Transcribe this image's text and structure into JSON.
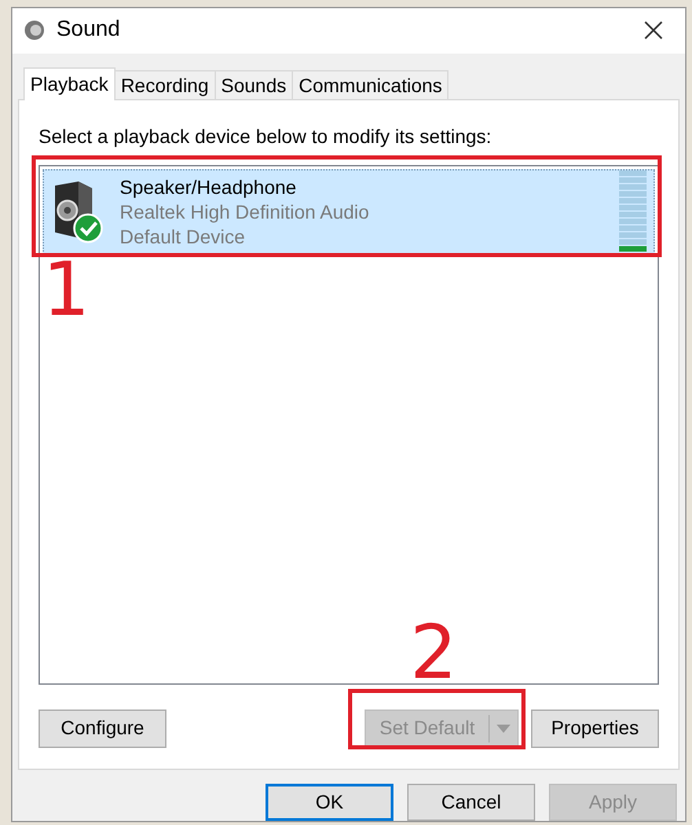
{
  "window": {
    "title": "Sound"
  },
  "tabs": [
    {
      "label": "Playback",
      "selected": true
    },
    {
      "label": "Recording",
      "selected": false
    },
    {
      "label": "Sounds",
      "selected": false
    },
    {
      "label": "Communications",
      "selected": false
    }
  ],
  "instruction": "Select a playback device below to modify its settings:",
  "devices": [
    {
      "name": "Speaker/Headphone",
      "driver": "Realtek High Definition Audio",
      "status": "Default Device",
      "selected": true,
      "is_default": true,
      "level": 0.08
    }
  ],
  "buttons": [
    {
      "label": "Configure",
      "disabled": false,
      "kind": "plain"
    },
    {
      "label": "Set Default",
      "disabled": true,
      "kind": "split"
    },
    {
      "label": "Properties",
      "disabled": false,
      "kind": "plain"
    }
  ],
  "dialog_buttons": [
    {
      "label": "OK",
      "disabled": false,
      "focused": true
    },
    {
      "label": "Cancel",
      "disabled": false,
      "focused": false
    },
    {
      "label": "Apply",
      "disabled": true,
      "focused": false
    }
  ],
  "annotations": [
    {
      "label": "1"
    },
    {
      "label": "2"
    }
  ]
}
